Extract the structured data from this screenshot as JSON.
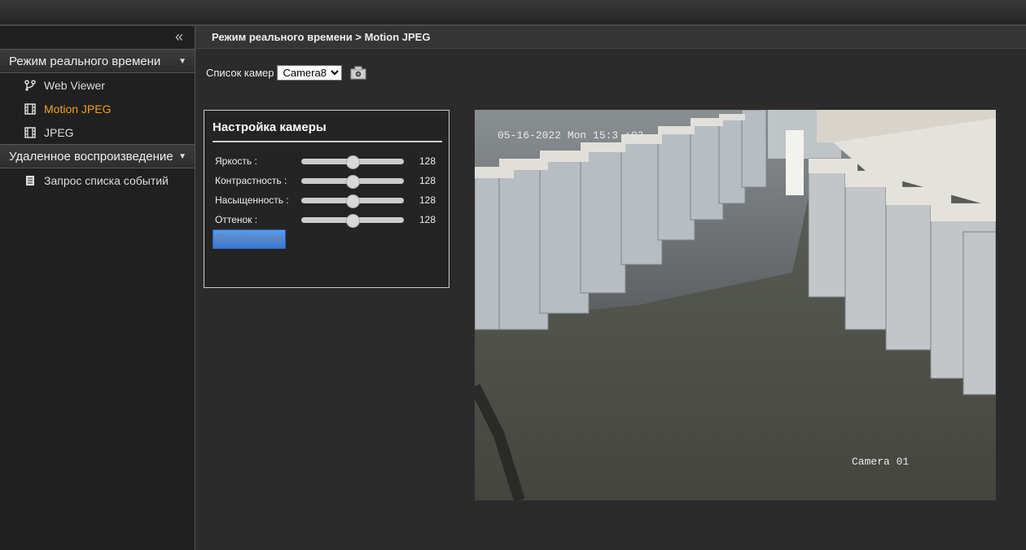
{
  "sidebar": {
    "collapse_icon": "double-chevron-left",
    "sections": [
      {
        "label": "Режим реального времени"
      },
      {
        "label": "Удаленное воспроизведение"
      }
    ],
    "live_items": [
      {
        "label": "Web Viewer",
        "icon": "branch-icon"
      },
      {
        "label": "Motion JPEG",
        "icon": "film-icon",
        "active": true
      },
      {
        "label": "JPEG",
        "icon": "film-icon"
      }
    ],
    "playback_items": [
      {
        "label": "Запрос списка событий",
        "icon": "document-icon"
      }
    ]
  },
  "header": {
    "breadcrumb": "Режим реального времени > Motion JPEG"
  },
  "camera_list": {
    "label": "Список камер",
    "selected": "Camera8"
  },
  "panel": {
    "title": "Настройка камеры",
    "sliders": [
      {
        "label": "Яркость :",
        "value": 128,
        "max": 255
      },
      {
        "label": "Контрастность :",
        "value": 128,
        "max": 255
      },
      {
        "label": "Насыщенность :",
        "value": 128,
        "max": 255
      },
      {
        "label": "Оттенок :",
        "value": 128,
        "max": 255
      }
    ],
    "default_button": "По умолчанию"
  },
  "video": {
    "timestamp": "05-16-2022 Mon 15:3 :03",
    "camera_name": "Camera 01"
  },
  "colors": {
    "accent": "#f0a020",
    "button": "#3b78d0"
  }
}
